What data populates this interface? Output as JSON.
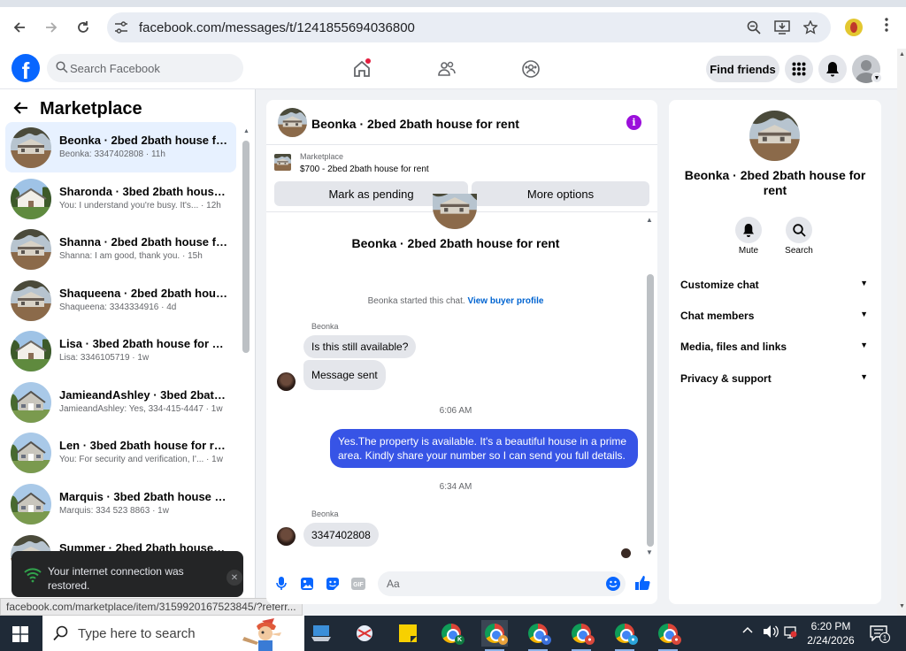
{
  "browser": {
    "url": "facebook.com/messages/t/1241855694036800",
    "status_url": "facebook.com/marketplace/item/3159920167523845/?referr..."
  },
  "fb": {
    "logo": "f",
    "search_placeholder": "Search Facebook",
    "find_friends": "Find friends"
  },
  "sidebar": {
    "title": "Marketplace",
    "conversations": [
      {
        "name": "Beonka · 2bed 2bath house for ...",
        "preview": "Beonka: 3347402808 · 11h",
        "house": "brown",
        "active": true
      },
      {
        "name": "Sharonda · 3bed 2bath house f...",
        "preview": "You: I understand you're busy. It's... · 12h",
        "house": "white"
      },
      {
        "name": "Shanna · 2bed 2bath house for ...",
        "preview": "Shanna: I am good, thank you. · 15h",
        "house": "brown"
      },
      {
        "name": "Shaqueena · 2bed 2bath house ...",
        "preview": "Shaqueena: 3343334916 · 4d",
        "house": "brown"
      },
      {
        "name": "Lisa · 3bed 2bath house for rent",
        "preview": "Lisa: 3346105719 · 1w",
        "house": "white"
      },
      {
        "name": "JamieandAshley · 3bed 2bath h...",
        "preview": "JamieandAshley: Yes, 334-415-4447 · 1w",
        "house": "gray"
      },
      {
        "name": "Len · 3bed 2bath house for rent",
        "preview": "You: For security and verification, I'... · 1w",
        "house": "gray"
      },
      {
        "name": "Marquis · 3bed 2bath house for...",
        "preview": "Marquis: 334 523 8863 · 1w",
        "house": "gray"
      },
      {
        "name": "Summer · 2bed 2bath house f...",
        "preview": "",
        "house": "brown"
      }
    ]
  },
  "toast": {
    "message": "Your internet connection was restored."
  },
  "chat": {
    "title": "Beonka · 2bed 2bath house for rent",
    "marketplace_label": "Marketplace",
    "listing": "$700 - 2bed 2bath house for rent",
    "mark_pending": "Mark as pending",
    "more_options": "More options",
    "body_name": "Beonka · 2bed 2bath house for rent",
    "started": "Beonka started this chat.",
    "view_profile": "View buyer profile",
    "sender1": "Beonka",
    "msg1": "Is this still available?",
    "msg2": "Message sent",
    "time1": "6:06 AM",
    "msg_out": "Yes.The property is available. It's a beautiful house in a prime area. Kindly share your number so I can send you full details.",
    "time2": "6:34 AM",
    "sender2": "Beonka",
    "msg3": "3347402808",
    "composer_placeholder": "Aa"
  },
  "rpanel": {
    "name": "Beonka · 2bed 2bath house for rent",
    "mute": "Mute",
    "search": "Search",
    "sections": [
      "Customize chat",
      "Chat members",
      "Media, files and links",
      "Privacy & support"
    ]
  },
  "taskbar": {
    "search": "Type here to search",
    "time": "6:20 PM",
    "date": "2/24/2026",
    "notifications": "1"
  },
  "colors": {
    "fb_blue": "#0866ff",
    "outgoing_bubble": "#3754e6",
    "info_purple": "#9b0fdb"
  }
}
